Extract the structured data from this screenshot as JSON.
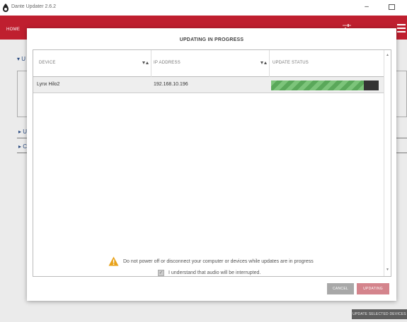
{
  "window": {
    "title": "Dante Updater 2.6.2",
    "minimize_glyph": "–"
  },
  "header": {
    "home_label": "HOME",
    "brand_color": "#bf1f2f"
  },
  "background": {
    "section_labels": [
      "U",
      "U",
      "C"
    ],
    "update_selected_label": "UPDATE SELECTED DEVICES"
  },
  "modal": {
    "title": "UPDATING IN PROGRESS",
    "columns": [
      {
        "label": "DEVICE",
        "sortable": true
      },
      {
        "label": "IP ADDRESS",
        "sortable": true
      },
      {
        "label": "UPDATE STATUS",
        "sortable": false
      }
    ],
    "rows": [
      {
        "device": "Lynx Hilo2",
        "ip": "192.168.10.196",
        "progress": 0.86
      }
    ],
    "warning": "Do not power off or disconnect your computer or devices while updates are in progress",
    "acknowledge": {
      "label": "I understand that audio will be interrupted.",
      "checked": true
    },
    "buttons": {
      "cancel": "CANCEL",
      "updating": "UPDATING"
    }
  },
  "icons": [
    "app-logo-icon",
    "sliders-icon",
    "hamburger-menu-icon",
    "sort-icon",
    "warning-icon",
    "checkbox-icon"
  ]
}
